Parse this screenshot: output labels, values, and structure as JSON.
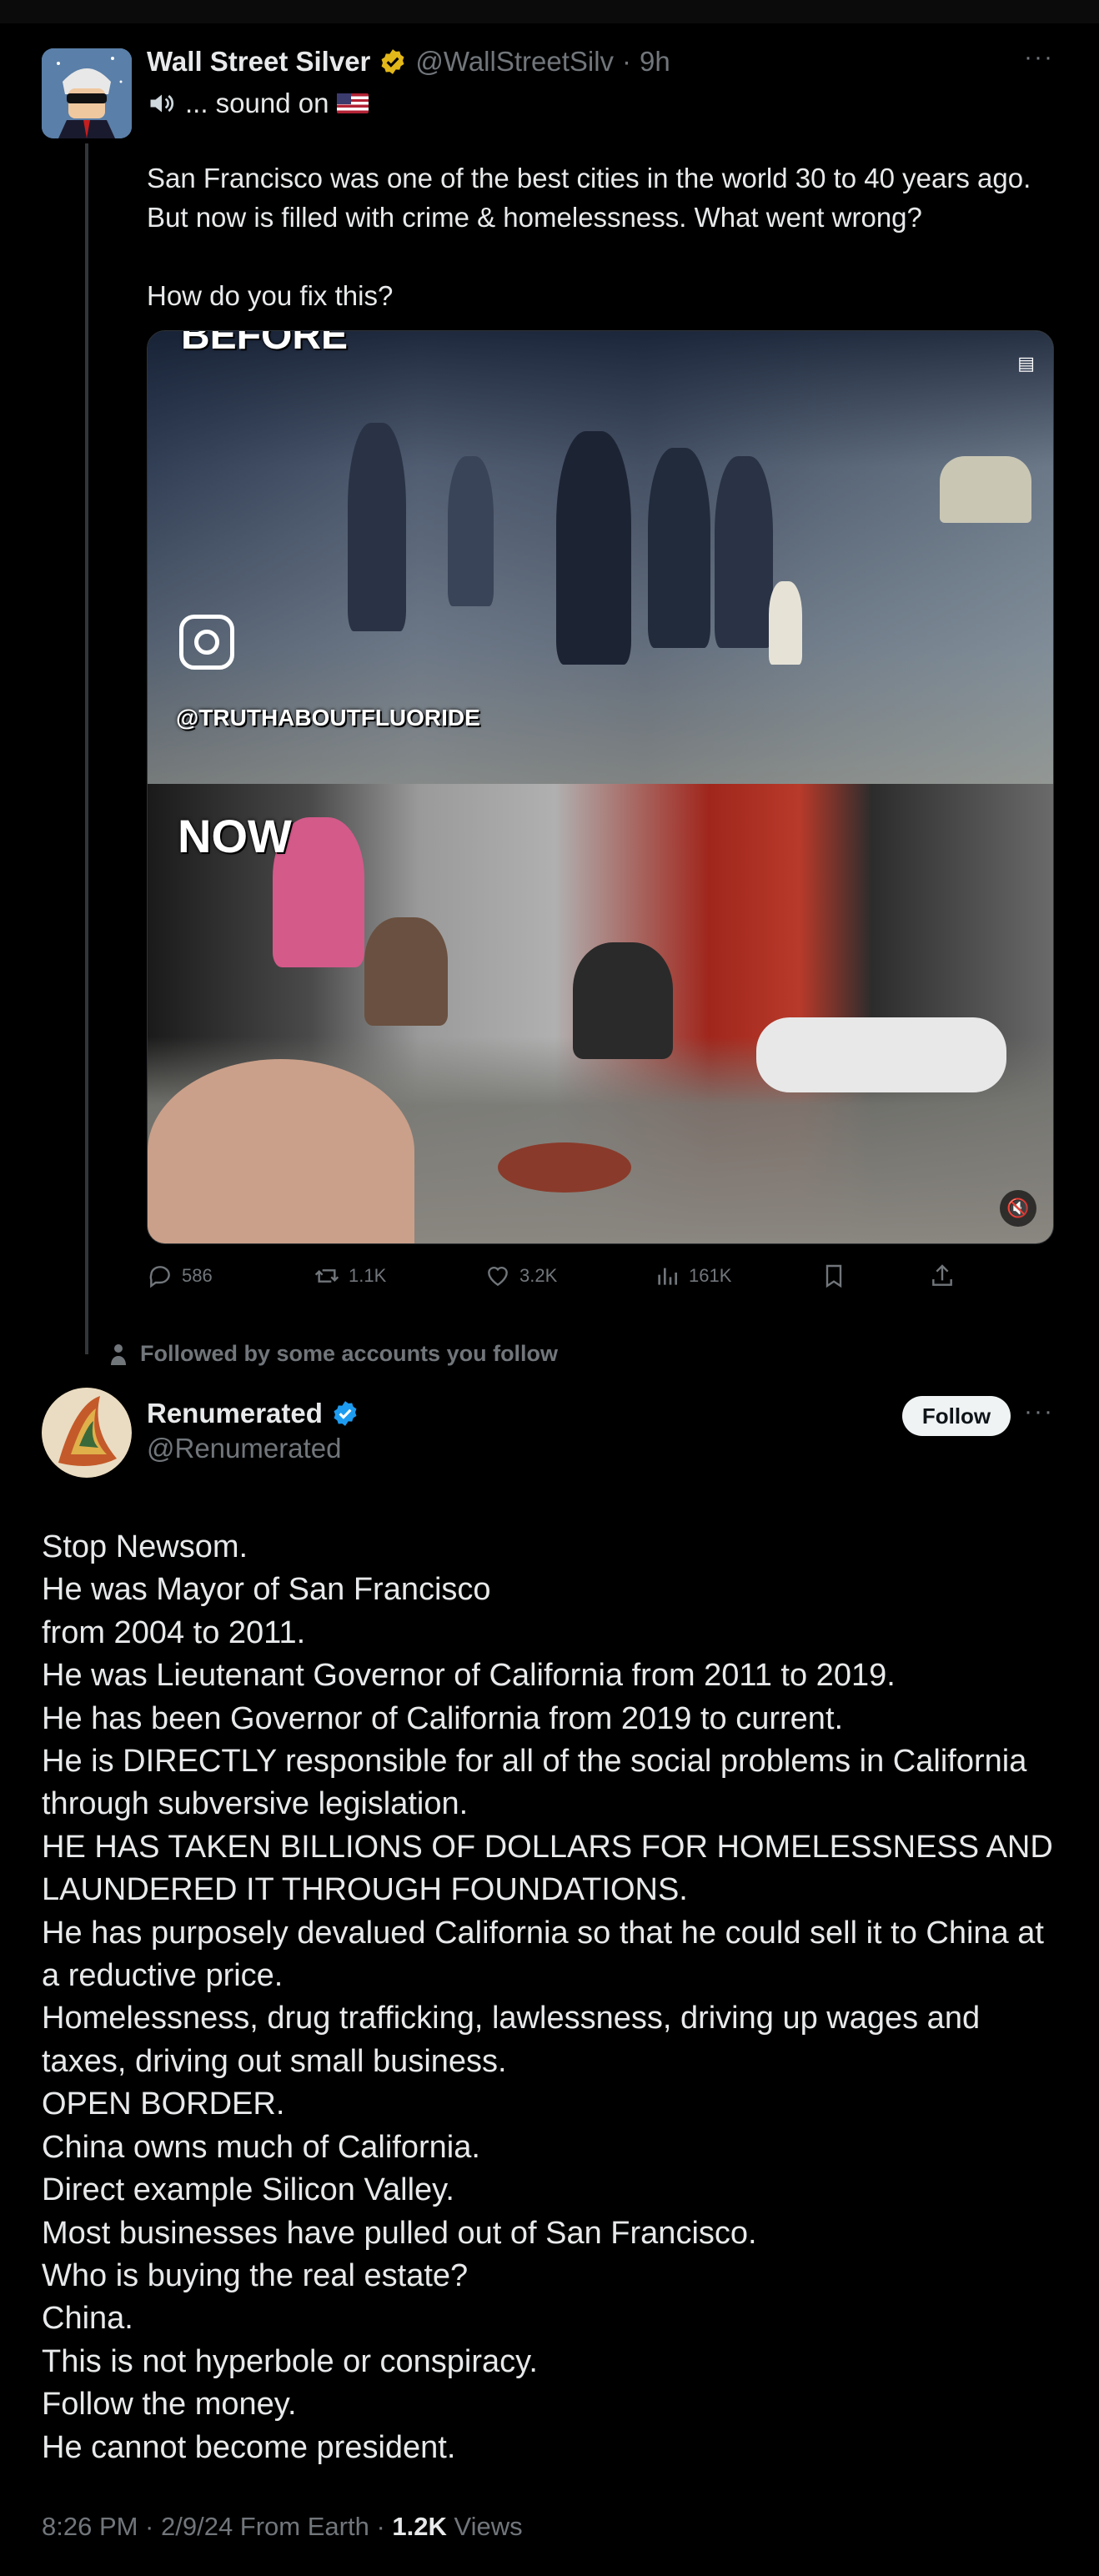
{
  "tweet1": {
    "author_name": "Wall Street Silver",
    "handle": "@WallStreetSilv",
    "time": "9h",
    "subline": "... sound on",
    "text": "San Francisco was one of the best cities in the world 30 to 40 years ago. But now is filled with crime & homelessness. What went wrong?\n\nHow do you fix this?",
    "media": {
      "top_label": "BEFORE",
      "watermark": "@TRUTHABOUTFLUORIDE",
      "bottom_label": "NOW"
    },
    "stats": {
      "replies": "586",
      "reposts": "1.1K",
      "likes": "3.2K",
      "views": "161K"
    }
  },
  "social_context": "Followed by some accounts you follow",
  "tweet2": {
    "author_name": "Renumerated",
    "handle": "@Renumerated",
    "follow_label": "Follow",
    "text": "Stop Newsom.\nHe was Mayor of San Francisco\nfrom 2004 to 2011.\nHe was Lieutenant Governor of California from 2011 to 2019.\nHe has been Governor of California from 2019 to current.\nHe is DIRECTLY responsible for all of the social problems in California through subversive legislation.\nHE HAS TAKEN BILLIONS OF DOLLARS FOR HOMELESSNESS AND LAUNDERED IT THROUGH FOUNDATIONS.\nHe has purposely devalued California so that he could sell it to China at a reductive price.\nHomelessness, drug trafficking, lawlessness, driving up wages and taxes, driving out small business.\nOPEN BORDER.\nChina owns much of California.\nDirect example Silicon Valley.\nMost businesses have pulled out of San Francisco.\nWho is buying the real estate?\nChina.\nThis is not hyperbole or conspiracy.\nFollow the money.\nHe cannot become president.",
    "meta_time": "8:26 PM · 2/9/24 From Earth · ",
    "views_count": "1.2K",
    "views_label": " Views"
  },
  "colors": {
    "background": "#000000",
    "text": "#e7e9ea",
    "muted": "#71767b",
    "verified_blue": "#1d9bf0",
    "verified_gold": "#e2b719"
  }
}
